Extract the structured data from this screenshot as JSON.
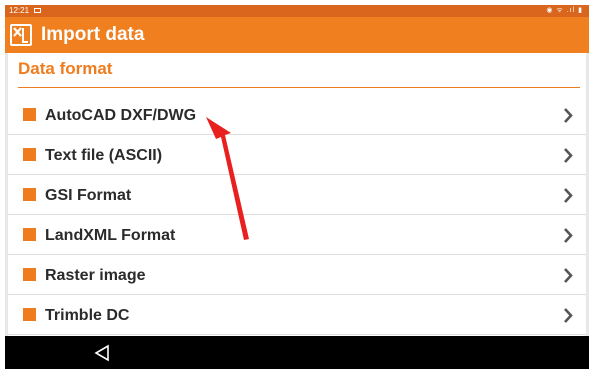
{
  "status_bar": {
    "time": "12:21",
    "right_icons": "◉ ᯤ .ıl ▮"
  },
  "app_bar": {
    "title": "Import data",
    "logo_icon": "app-logo-icon"
  },
  "section": {
    "title": "Data format"
  },
  "formats": [
    {
      "label": "AutoCAD DXF/DWG"
    },
    {
      "label": "Text file (ASCII)"
    },
    {
      "label": "GSI Format"
    },
    {
      "label": "LandXML Format"
    },
    {
      "label": "Raster image"
    },
    {
      "label": "Trimble DC"
    }
  ],
  "colors": {
    "accent": "#f07f20",
    "status_bar": "#d9661c",
    "annotation": "#e8201f"
  }
}
